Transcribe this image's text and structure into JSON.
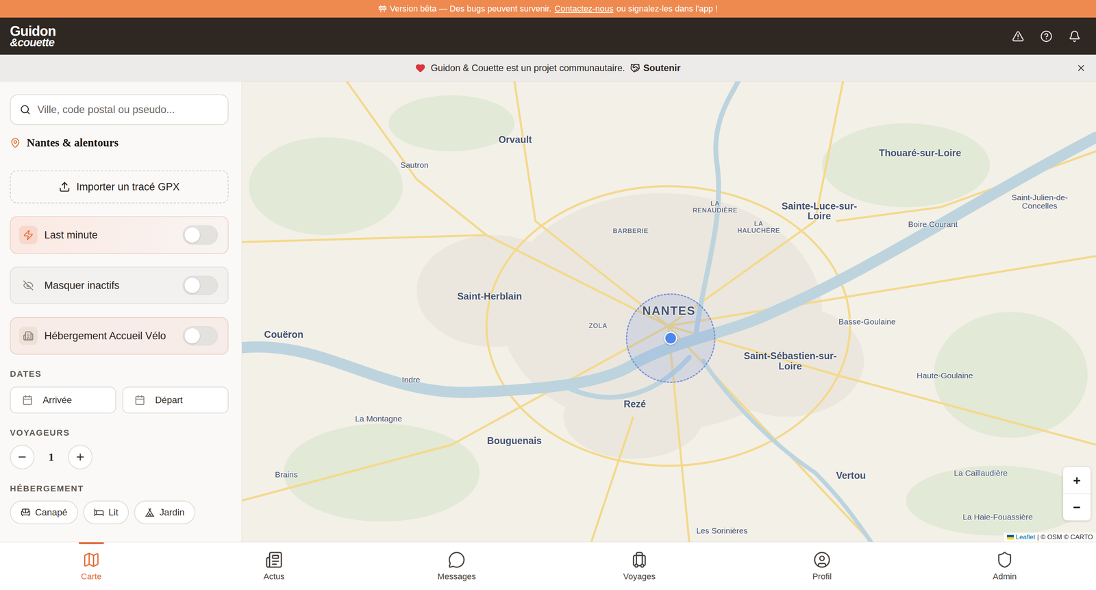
{
  "beta_banner": {
    "text": "Version bêta — Des bugs peuvent survenir.",
    "link": "Contactez-nous",
    "after": "ou signalez-les dans l'app !"
  },
  "header": {
    "logo": {
      "line1": "Guidon",
      "line2": "&couette"
    }
  },
  "community_bar": {
    "text": "Guidon & Couette est un projet communautaire.",
    "action": "Soutenir"
  },
  "sidebar": {
    "search_placeholder": "Ville, code postal ou pseudo...",
    "location": "Nantes & alentours",
    "gpx_button": "Importer un tracé GPX",
    "toggles": [
      {
        "label": "Last minute",
        "on": false,
        "kind": "accent"
      },
      {
        "label": "Masquer inactifs",
        "on": false,
        "kind": "plain"
      },
      {
        "label": "Hébergement Accueil Vélo",
        "on": false,
        "kind": "soft"
      }
    ],
    "dates": {
      "label": "DATES",
      "arrival": "Arrivée",
      "departure": "Départ"
    },
    "travelers": {
      "label": "VOYAGEURS",
      "count": "1"
    },
    "accommodation": {
      "label": "HÉBERGEMENT",
      "options": [
        {
          "label": "Canapé",
          "selected": false
        },
        {
          "label": "Lit",
          "selected": false
        },
        {
          "label": "Jardin",
          "selected": false
        }
      ]
    }
  },
  "map": {
    "labels": [
      {
        "text": "Orvault",
        "kind": "town"
      },
      {
        "text": "Sautron",
        "kind": "small"
      },
      {
        "text": "Thouaré-sur-Loire",
        "kind": "town"
      },
      {
        "text": "Saint-Julien-de-Concelles",
        "kind": "small"
      },
      {
        "text": "LA RENAUDIÈRE",
        "kind": "district"
      },
      {
        "text": "Sainte-Luce-sur-Loire",
        "kind": "town"
      },
      {
        "text": "Boire Courant",
        "kind": "small"
      },
      {
        "text": "BARBERIE",
        "kind": "district"
      },
      {
        "text": "LA HALUCHÈRE",
        "kind": "district"
      },
      {
        "text": "Saint-Herblain",
        "kind": "town"
      },
      {
        "text": "NANTES",
        "kind": "city"
      },
      {
        "text": "ZOLA",
        "kind": "district"
      },
      {
        "text": "Basse-Goulaine",
        "kind": "small"
      },
      {
        "text": "Couëron",
        "kind": "town"
      },
      {
        "text": "Saint-Sébastien-sur-Loire",
        "kind": "town"
      },
      {
        "text": "Indre",
        "kind": "small"
      },
      {
        "text": "Rezé",
        "kind": "town"
      },
      {
        "text": "Haute-Goulaine",
        "kind": "small"
      },
      {
        "text": "La Montagne",
        "kind": "small"
      },
      {
        "text": "Bouguenais",
        "kind": "town"
      },
      {
        "text": "Brains",
        "kind": "small"
      },
      {
        "text": "Vertou",
        "kind": "town"
      },
      {
        "text": "La Caillaudière",
        "kind": "small"
      },
      {
        "text": "La Haie-Fouassière",
        "kind": "small"
      },
      {
        "text": "Les Sorinières",
        "kind": "small"
      }
    ],
    "zoom_in": "+",
    "zoom_out": "−",
    "attribution": {
      "link": "Leaflet",
      "rest": "| © OSM © CARTO"
    }
  },
  "nav": [
    {
      "label": "Carte",
      "selected": true
    },
    {
      "label": "Actus",
      "selected": false
    },
    {
      "label": "Messages",
      "selected": false
    },
    {
      "label": "Voyages",
      "selected": false
    },
    {
      "label": "Profil",
      "selected": false
    },
    {
      "label": "Admin",
      "selected": false
    }
  ]
}
